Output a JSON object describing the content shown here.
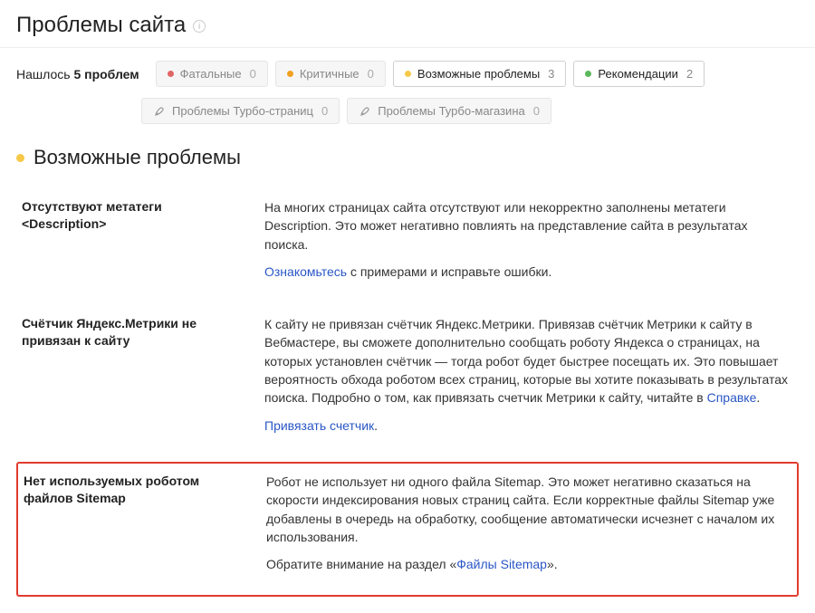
{
  "header": {
    "title": "Проблемы сайта"
  },
  "filters": {
    "found_prefix": "Нашлось",
    "found_count": "5 проблем",
    "fatal": {
      "label": "Фатальные",
      "count": "0"
    },
    "critical": {
      "label": "Критичные",
      "count": "0"
    },
    "possible": {
      "label": "Возможные проблемы",
      "count": "3"
    },
    "recommend": {
      "label": "Рекомендации",
      "count": "2"
    },
    "turbo_pages": {
      "label": "Проблемы Турбо-страниц",
      "count": "0"
    },
    "turbo_shop": {
      "label": "Проблемы Турбо-магазина",
      "count": "0"
    }
  },
  "section": {
    "title": "Возможные проблемы"
  },
  "issues": [
    {
      "name": "Отсутствуют метатеги <Description>",
      "desc": "На многих страницах сайта отсутствуют или некорректно заполнены метатеги Description. Это может негативно повлиять на представление сайта в результатах поиска.",
      "action_link": "Ознакомьтесь",
      "action_tail": " с примерами и исправьте ошибки."
    },
    {
      "name": "Счётчик Яндекс.Метрики не привязан к сайту",
      "desc": "К сайту не привязан счётчик Яндекс.Метрики. Привязав счётчик Метрики к сайту в Вебмастере, вы сможете дополнительно сообщать роботу Яндекса о страницах, на которых установлен счётчик — тогда робот будет быстрее посещать их. Это повышает вероятность обхода роботом всех страниц, которые вы хотите показывать в результатах поиска. Подробно о том, как привязать счетчик Метрики к сайту, читайте в ",
      "desc_link": "Справке",
      "desc_tail": ".",
      "action_link": "Привязать счетчик",
      "action_tail": "."
    },
    {
      "name": "Нет используемых роботом файлов Sitemap",
      "desc": "Робот не использует ни одного файла Sitemap. Это может негативно сказаться на скорости индексирования новых страниц сайта. Если корректные файлы Sitemap уже добавлены в очередь на обработку, сообщение автоматически исчезнет с началом их использования.",
      "action_prefix": "Обратите внимание на раздел «",
      "action_link": "Файлы Sitemap",
      "action_tail": "»."
    }
  ]
}
